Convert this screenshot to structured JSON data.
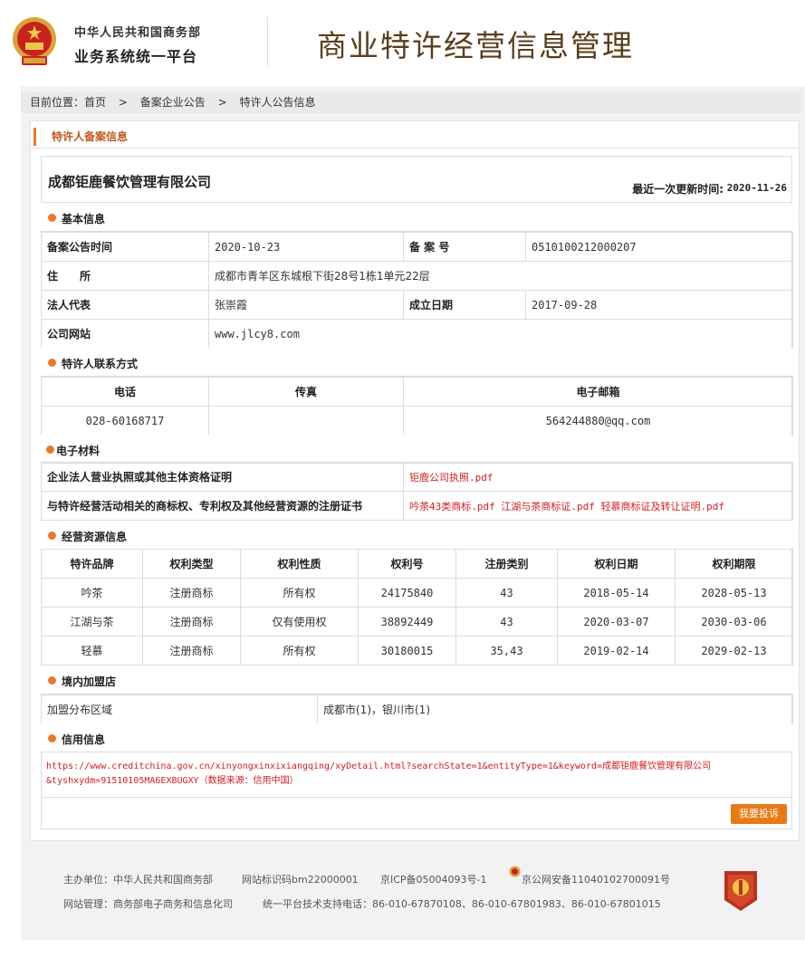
{
  "header": {
    "ministry": "中华人民共和国商务部",
    "platform": "业务系统统一平台",
    "system_title": "商业特许经营信息管理"
  },
  "breadcrumb": {
    "label": "目前位置：",
    "items": [
      "首页",
      ">",
      "备案企业公告",
      ">",
      "特许人公告信息"
    ]
  },
  "panel_title": "特许人备案信息",
  "company": {
    "name": "成都钜鹿餐饮管理有限公司",
    "update_label": "最近一次更新时间:",
    "update_value": "2020-11-26"
  },
  "basic": {
    "title": "基本信息",
    "rows": [
      {
        "k1": "备案公告时间",
        "v1": "2020-10-23",
        "k2": "备 案 号",
        "v2": "0510100212000207"
      },
      {
        "k1": "住　　所",
        "v1": "成都市青羊区东城根下街28号1栋1单元22层"
      },
      {
        "k1": "法人代表",
        "v1": "张崇霞",
        "k2": "成立日期",
        "v2": "2017-09-28"
      },
      {
        "k1": "公司网站",
        "v1": "www.jlcy8.com"
      }
    ]
  },
  "contact": {
    "title": "特许人联系方式",
    "headers": [
      "电话",
      "传真",
      "电子邮箱"
    ],
    "values": [
      "028-60168717",
      "",
      "564244880@qq.com"
    ]
  },
  "materials": {
    "title": "电子材料",
    "rows": [
      {
        "label": "企业法人营业执照或其他主体资格证明",
        "files": [
          "钜鹿公司执照.pdf"
        ]
      },
      {
        "label": "与特许经营活动相关的商标权、专利权及其他经营资源的注册证书",
        "files": [
          "吟茶43类商标.pdf",
          "江湖与茶商标证.pdf",
          "轻慕商标证及转让证明.pdf"
        ]
      }
    ]
  },
  "resources": {
    "title": "经营资源信息",
    "headers": [
      "特许品牌",
      "权利类型",
      "权利性质",
      "权利号",
      "注册类别",
      "权利日期",
      "权利期限"
    ],
    "rows": [
      [
        "吟茶",
        "注册商标",
        "所有权",
        "24175840",
        "43",
        "2018-05-14",
        "2028-05-13"
      ],
      [
        "江湖与茶",
        "注册商标",
        "仅有使用权",
        "38892449",
        "43",
        "2020-03-07",
        "2030-03-06"
      ],
      [
        "轻慕",
        "注册商标",
        "所有权",
        "30180015",
        "35,43",
        "2019-02-14",
        "2029-02-13"
      ]
    ]
  },
  "franchise": {
    "title": "境内加盟店",
    "label": "加盟分布区域",
    "value": "成都市(1)，银川市(1)"
  },
  "credit": {
    "title": "信用信息",
    "url_line1": "https://www.creditchina.gov.cn/xinyongxinxixiangqing/xyDetail.html?searchState=1&entityType=1&keyword=成都钜鹿餐饮管理有限公司",
    "url_line2": "&tyshxydm=91510105MA6EXBUGXY（数据来源：信用中国）"
  },
  "complaint_button": "我要投诉",
  "footer": {
    "sponsor": "主办单位：中华人民共和国商务部",
    "site_id": "网站标识码bm22000001",
    "icp": "京ICP备05004093号-1",
    "police": "京公网安备11040102700091号",
    "manager": "网站管理：商务部电子商务和信息化司",
    "support": "统一平台技术支持电话：86-010-67870108、86-010-67801983、86-010-67801015"
  },
  "colors": {
    "accent": "#e87a2a",
    "link_red": "#d02020",
    "title_brown": "#5a3e1b"
  }
}
